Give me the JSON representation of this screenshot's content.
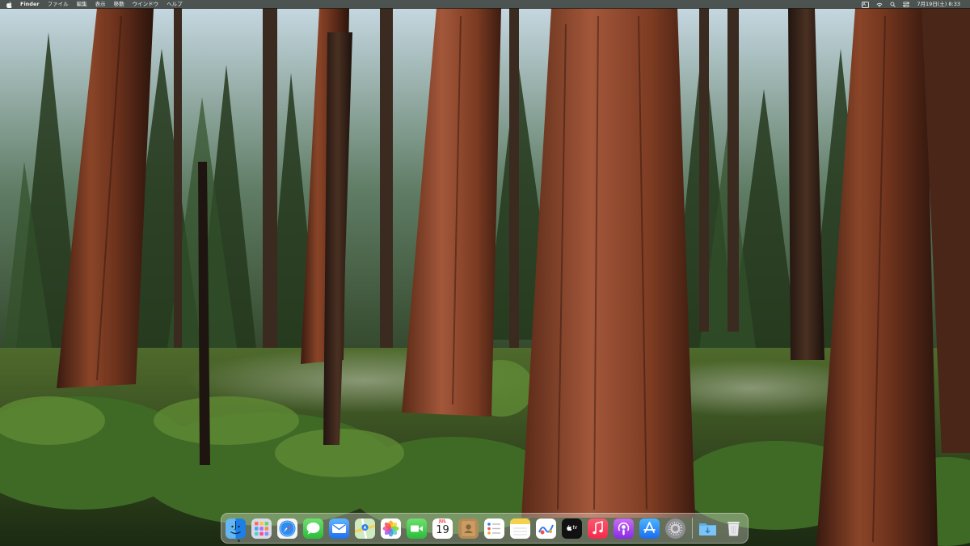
{
  "menubar": {
    "app_name": "Finder",
    "menus": [
      "ファイル",
      "編集",
      "表示",
      "移動",
      "ウインドウ",
      "ヘルプ"
    ],
    "input_source": "A",
    "datetime": "7月19日(土) 8:33"
  },
  "dock": {
    "apps": [
      {
        "name": "Finder",
        "icon": "finder-icon",
        "running": true
      },
      {
        "name": "Launchpad",
        "icon": "launchpad-icon"
      },
      {
        "name": "Safari",
        "icon": "safari-icon"
      },
      {
        "name": "Messages",
        "icon": "messages-icon"
      },
      {
        "name": "Mail",
        "icon": "mail-icon"
      },
      {
        "name": "Maps",
        "icon": "maps-icon"
      },
      {
        "name": "Photos",
        "icon": "photos-icon"
      },
      {
        "name": "FaceTime",
        "icon": "facetime-icon"
      },
      {
        "name": "Calendar",
        "icon": "calendar-icon",
        "month": "JUL",
        "day": "19"
      },
      {
        "name": "Contacts",
        "icon": "contacts-icon"
      },
      {
        "name": "Reminders",
        "icon": "reminders-icon"
      },
      {
        "name": "Notes",
        "icon": "notes-icon"
      },
      {
        "name": "Freeform",
        "icon": "freeform-icon"
      },
      {
        "name": "TV",
        "icon": "tv-icon",
        "label": "tv"
      },
      {
        "name": "Music",
        "icon": "music-icon"
      },
      {
        "name": "Podcasts",
        "icon": "podcasts-icon"
      },
      {
        "name": "App Store",
        "icon": "app-store-icon"
      },
      {
        "name": "System Settings",
        "icon": "system-settings-icon"
      }
    ],
    "stacks": [
      {
        "name": "Downloads",
        "icon": "downloads-folder-icon"
      },
      {
        "name": "Trash",
        "icon": "trash-icon"
      }
    ]
  },
  "colors": {
    "menubar_bg": "#1c1e18",
    "dock_bg": "#f5f5f0",
    "sky": "#c8dbe6",
    "redwood": "#7a3a22",
    "foliage": "#2f4a1e"
  }
}
